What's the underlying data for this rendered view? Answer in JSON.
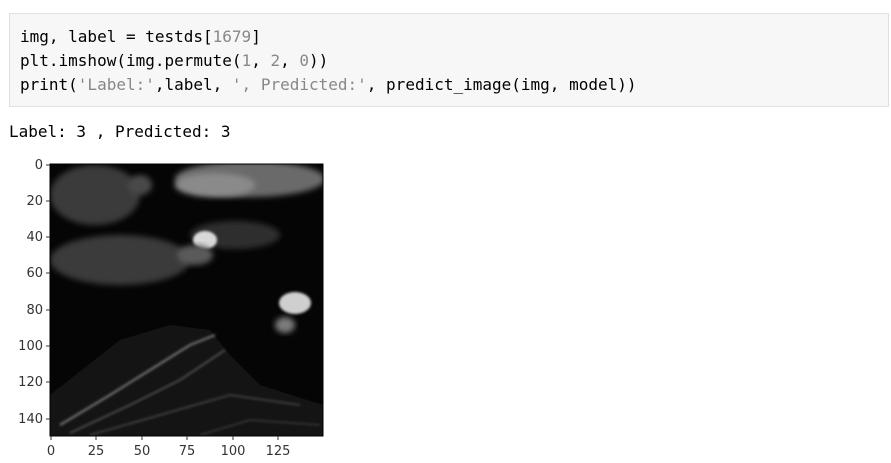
{
  "code_cell": {
    "line1": {
      "prefix": "img, label = testds[",
      "index": "1679",
      "suffix": "]"
    },
    "line2": {
      "prefix": "plt.imshow(img.permute(",
      "a": "1",
      "sep1": ", ",
      "b": "2",
      "sep2": ", ",
      "c": "0",
      "suffix": "))"
    },
    "line3": {
      "prefix": "print(",
      "s1": "'Label:'",
      "mid": ",label, ",
      "s2": "', Predicted:'",
      "suffix": ", predict_image(img, model))"
    }
  },
  "output": {
    "text": "Label: 3 , Predicted: 3"
  },
  "plot": {
    "image_description_icon": "grayscale-landscape-image",
    "y_ticks": [
      "0",
      "20",
      "40",
      "60",
      "80",
      "100",
      "120",
      "140"
    ],
    "x_ticks": [
      "0",
      "25",
      "50",
      "75",
      "100",
      "125"
    ]
  },
  "colors": {
    "cell_bg": "#f7f7f7",
    "cell_border": "#e0e0e0",
    "token_gray": "#888888"
  }
}
